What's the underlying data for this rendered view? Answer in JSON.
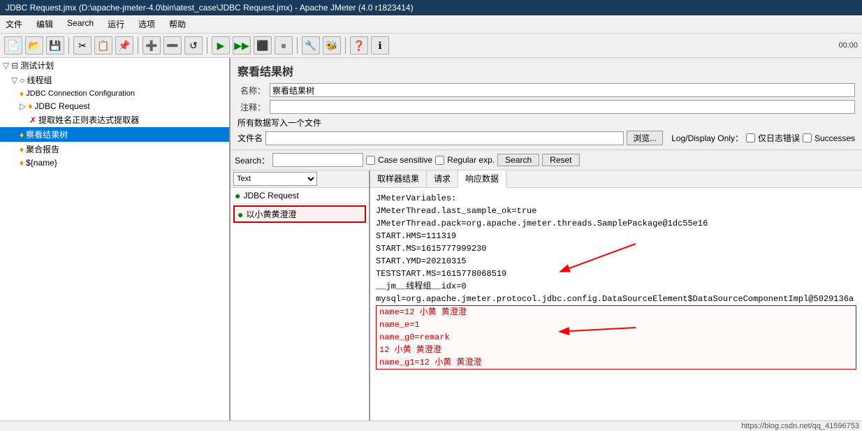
{
  "titleBar": {
    "text": "JDBC Request.jmx (D:\\apache-jmeter-4.0\\bin\\atest_case\\JDBC Request.jmx) - Apache JMeter (4.0 r1823414)"
  },
  "menuBar": {
    "items": [
      "文件",
      "编辑",
      "Search",
      "运行",
      "选项",
      "帮助"
    ]
  },
  "toolbar": {
    "time": "00:00"
  },
  "leftPanel": {
    "treeItems": [
      {
        "id": "test-plan",
        "label": "测试计划",
        "indent": 0,
        "icon": "▽",
        "hasToggle": true
      },
      {
        "id": "thread-group",
        "label": "线程组",
        "indent": 1,
        "icon": "○",
        "hasToggle": true
      },
      {
        "id": "jdbc-conn",
        "label": "JDBC Connection Configuration",
        "indent": 2,
        "icon": "♦"
      },
      {
        "id": "jdbc-req",
        "label": "JDBC Request",
        "indent": 2,
        "icon": "♦",
        "hasToggle": true
      },
      {
        "id": "extractor",
        "label": "提取姓名正则表达式提取器",
        "indent": 3,
        "icon": "✗"
      },
      {
        "id": "result-tree",
        "label": "察看结果树",
        "indent": 2,
        "icon": "♦",
        "selected": true
      },
      {
        "id": "agg-report",
        "label": "聚合报告",
        "indent": 2,
        "icon": "♦"
      },
      {
        "id": "varname",
        "label": "${name}",
        "indent": 2,
        "icon": "♦"
      }
    ]
  },
  "rightPanel": {
    "title": "察看结果树",
    "nameLabel": "名称：",
    "nameValue": "察看结果树",
    "commentLabel": "注释：",
    "commentValue": "",
    "fileSection": {
      "label": "所有数据写入一个文件",
      "fileLabel": "文件名",
      "browseBtn": "浏览...",
      "logDisplayLabel": "Log/Display Only：",
      "checkboxes": [
        {
          "id": "cb-errors",
          "label": "仅日志错误"
        },
        {
          "id": "cb-success",
          "label": "Successes"
        }
      ]
    },
    "searchBar": {
      "label": "Search：",
      "placeholder": "",
      "caseSensitive": "Case sensitive",
      "regularExp": "Regular exp.",
      "searchBtn": "Search",
      "resetBtn": "Reset"
    },
    "listPanel": {
      "headerLabel": "Text",
      "items": [
        {
          "id": "jdbc-req-item",
          "label": "JDBC Request",
          "status": "green"
        },
        {
          "id": "sub-item",
          "label": "以小黄黄澄澄",
          "status": "green",
          "highlighted": true
        }
      ]
    },
    "detailPanel": {
      "tabs": [
        {
          "id": "sampler-result",
          "label": "取样器结果",
          "active": false
        },
        {
          "id": "request",
          "label": "请求",
          "active": false
        },
        {
          "id": "response-data",
          "label": "响应数据",
          "active": true
        }
      ],
      "content": {
        "lines": [
          "JMeterVariables:",
          "JMeterThread.last_sample_ok=true",
          "JMeterThread.pack=org.apache.jmeter.threads.SamplePackage@1dc55e16",
          "START.HMS=111319",
          "START.MS=1615777999230",
          "START.YMD=20210315",
          "TESTSTART.MS=1615778068519",
          "__jm__线程组__idx=0",
          "mysql=org.apache.jmeter.protocol.jdbc.config.DataSourceElement$DataSourceComponentImpl@5029136a",
          "name=12 小黄    黄澄澄",
          "name_e=1",
          "name_g0=remark",
          "12       小黄    黄澄澄",
          "name_g1=12    小黄    黄澄澄"
        ],
        "highlightStart": 9,
        "highlightEnd": 13
      }
    }
  },
  "statusBar": {
    "text": "https://blog.csdn.net/qq_41596753"
  }
}
